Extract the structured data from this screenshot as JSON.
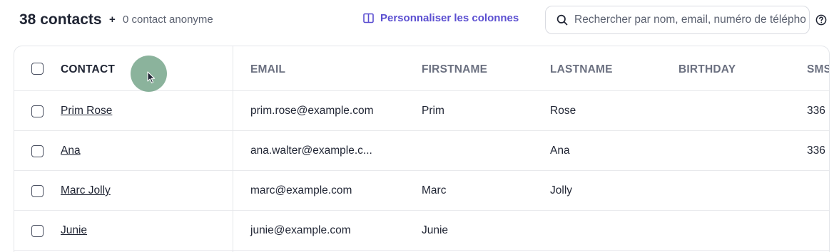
{
  "header": {
    "contact_count": "38 contacts",
    "plus": "+",
    "anonymous": "0 contact anonyme",
    "customize_label": "Personnaliser les colonnes",
    "search_placeholder": "Rechercher par nom, email, numéro de téléphone",
    "icons": {
      "customize": "columns-icon",
      "search": "search-icon",
      "help": "help-circle-icon"
    }
  },
  "table": {
    "columns": [
      "CONTACT",
      "EMAIL",
      "FIRSTNAME",
      "LASTNAME",
      "BIRTHDAY",
      "SMS"
    ],
    "rows": [
      {
        "contact": "Prim Rose",
        "email": "prim.rose@example.com",
        "firstname": "Prim",
        "lastname": "Rose",
        "birthday": "",
        "sms": "336"
      },
      {
        "contact": "Ana",
        "email": "ana.walter@example.c...",
        "firstname": "",
        "lastname": "Ana",
        "birthday": "",
        "sms": "336"
      },
      {
        "contact": "Marc Jolly",
        "email": "marc@example.com",
        "firstname": "Marc",
        "lastname": "Jolly",
        "birthday": "",
        "sms": ""
      },
      {
        "contact": "Junie",
        "email": "junie@example.com",
        "firstname": "Junie",
        "lastname": "",
        "birthday": "",
        "sms": ""
      }
    ]
  },
  "colors": {
    "accent": "#5b4fd1",
    "text": "#1f2433",
    "muted": "#6b7080",
    "cursor_highlight": "#6a9e80"
  }
}
